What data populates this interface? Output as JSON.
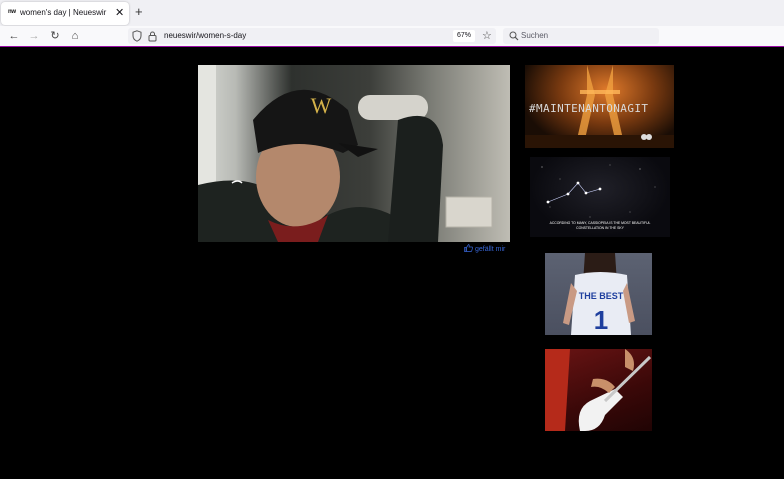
{
  "browser": {
    "tab": {
      "favicon_text": "nw",
      "title": "women's day | Neueswir",
      "close_glyph": "✕"
    },
    "new_tab_glyph": "+",
    "nav": {
      "back_glyph": "←",
      "forward_glyph": "→",
      "reload_glyph": "↻",
      "home_glyph": "⌂"
    },
    "url": "neueswir/women-s-day",
    "zoom": "67%",
    "bookmark_glyph": "☆",
    "search_placeholder": "Suchen"
  },
  "page": {
    "like_label": "gefällt mir",
    "thumbnails": [
      {
        "overlay_text": "#MAINTENANTONAGIT"
      },
      {
        "caption": "ACCORDING TO MANY, CASSIOPEIA IS THE MOST BEAUTIFUL CONSTELLATION IN THE SKY"
      },
      {
        "jersey_text": "THE BEST",
        "jersey_number": "1"
      },
      {}
    ]
  },
  "colors": {
    "accent_line": "#9b0ca7",
    "like_blue": "#3866d6",
    "page_bg": "#000000"
  }
}
